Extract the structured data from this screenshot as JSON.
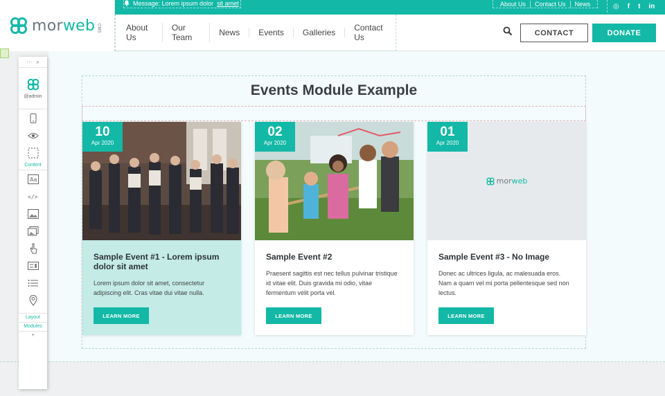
{
  "header": {
    "logo_text_a": "mor",
    "logo_text_b": "web",
    "logo_sub": "CMS",
    "message_prefix": "Message: Lorem ipsum dolor ",
    "message_link": "sit amet",
    "top_links": [
      "About Us",
      "Contact Us",
      "News"
    ],
    "socials": [
      "instagram-icon",
      "facebook-icon",
      "twitter-icon",
      "linkedin-icon"
    ],
    "social_glyphs": [
      "◎",
      "f",
      "t",
      "in"
    ],
    "nav_items": [
      "About Us",
      "Our Team",
      "News",
      "Events",
      "Galleries",
      "Contact Us"
    ],
    "contact_label": "CONTACT",
    "donate_label": "DONATE"
  },
  "main": {
    "title": "Events Module Example",
    "events": [
      {
        "day": "10",
        "month": "Apr 2020",
        "title": "Sample Event #1 - Lorem ipsum dolor sit amet",
        "text": "Lorem ipsum dolor sit amet, consectetur adipiscing elit. Cras vitae dui vitae nulla.",
        "button": "LEARN MORE",
        "image": "party-crowd-photo"
      },
      {
        "day": "02",
        "month": "Apr 2020",
        "title": "Sample Event #2",
        "text": "Praesent sagittis est nec tellus pulvinar tristique id vitae elit. Duis gravida mi odio, vitae fermentum velit porta vel.",
        "button": "LEARN MORE",
        "image": "tug-of-war-photo"
      },
      {
        "day": "01",
        "month": "Apr 2020",
        "title": "Sample Event #3 - No Image",
        "text": "Donec ac ultrices ligula, ac malesuada eros. Nam a quam vel mi porta pellentesque sed non lectus.",
        "button": "LEARN MORE",
        "image": "placeholder-logo",
        "placeholder_logo_a": "mor",
        "placeholder_logo_b": "web"
      }
    ]
  },
  "editor_sidebar": {
    "user": "@admin",
    "content_label": "Content",
    "layout_label": "Layout",
    "modules_label": "Modules",
    "add_glyph": "+",
    "tools": [
      "mobile-icon",
      "eye-icon",
      "select-frame-icon",
      "text-icon",
      "code-icon",
      "image-icon",
      "gallery-icon",
      "button-icon",
      "form-icon",
      "list-icon",
      "map-pin-icon"
    ]
  },
  "colors": {
    "brand": "#13b8a6",
    "teal_light": "#c4ebe5",
    "page_bg": "#f3fbfc"
  }
}
